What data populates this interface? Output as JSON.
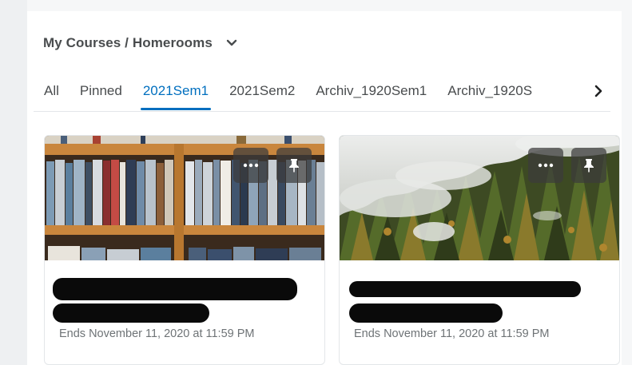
{
  "header": {
    "title": "My Courses / Homerooms"
  },
  "tabs": [
    {
      "label": "All",
      "active": false
    },
    {
      "label": "Pinned",
      "active": false
    },
    {
      "label": "2021Sem1",
      "active": true
    },
    {
      "label": "2021Sem2",
      "active": false
    },
    {
      "label": "Archiv_1920Sem1",
      "active": false
    },
    {
      "label": "Archiv_1920S",
      "active": false
    }
  ],
  "colors": {
    "accent": "#006fbf",
    "text": "#494c4e",
    "muted": "#6e7376"
  },
  "cards": [
    {
      "image": "bookshelf",
      "title": "[redacted]",
      "ends": "Ends November 11, 2020 at 11:59 PM"
    },
    {
      "image": "foggy-forest",
      "title": "[redacted]",
      "ends": "Ends November 11, 2020 at 11:59 PM"
    }
  ],
  "icons": {
    "header_dropdown": "chevron-down-icon",
    "tabs_next": "chevron-right-icon",
    "card_more": "more-icon",
    "card_pin": "pin-icon"
  }
}
